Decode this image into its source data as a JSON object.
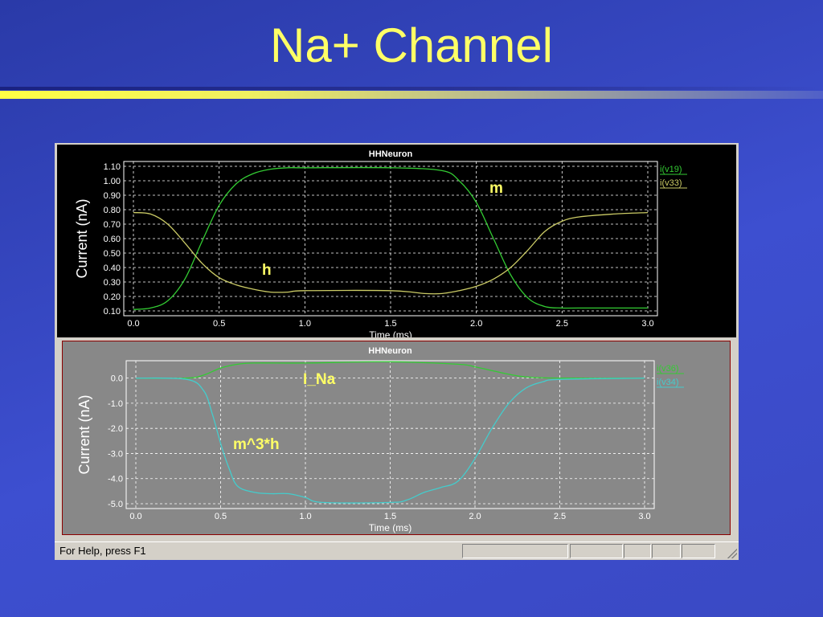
{
  "slide": {
    "title": "Na+ Channel"
  },
  "colors": {
    "background": "#3a49c4",
    "title": "#ffff66",
    "series_green": "#33cc33",
    "series_yellow": "#cccc66",
    "series_cyan": "#44cccc",
    "annotation": "#ffff66"
  },
  "statusbar": {
    "help_text": "For Help, press F1"
  },
  "annotations": {
    "m": "m",
    "h": "h",
    "i_na": "I_Na",
    "m3h": "m^3*h"
  },
  "chart_data": [
    {
      "type": "line",
      "title": "HHNeuron",
      "xlabel": "Time (ms)",
      "ylabel": "Current (nA)",
      "xlim": [
        0.0,
        3.0
      ],
      "ylim": [
        0.1,
        1.1
      ],
      "xticks": [
        "0.0",
        "0.5",
        "1.0",
        "1.5",
        "2.0",
        "2.5",
        "3.0"
      ],
      "yticks": [
        "0.10",
        "0.20",
        "0.30",
        "0.40",
        "0.50",
        "0.60",
        "0.70",
        "0.80",
        "0.90",
        "1.00",
        "1.10"
      ],
      "grid": true,
      "legend": "top-right",
      "background": "black",
      "series": [
        {
          "name": "i(v19)",
          "color": "#33cc33",
          "x": [
            0.0,
            0.1,
            0.2,
            0.3,
            0.4,
            0.5,
            0.6,
            0.7,
            0.8,
            0.9,
            1.0,
            1.5,
            1.8,
            1.9,
            2.0,
            2.1,
            2.2,
            2.3,
            2.4,
            2.5,
            2.6,
            3.0
          ],
          "y": [
            0.11,
            0.12,
            0.17,
            0.32,
            0.58,
            0.83,
            0.98,
            1.05,
            1.08,
            1.09,
            1.09,
            1.09,
            1.07,
            1.0,
            0.85,
            0.6,
            0.35,
            0.19,
            0.13,
            0.12,
            0.12,
            0.12
          ]
        },
        {
          "name": "i(v33)",
          "color": "#cccc66",
          "x": [
            0.0,
            0.1,
            0.2,
            0.3,
            0.4,
            0.5,
            0.6,
            0.7,
            0.8,
            0.9,
            1.0,
            1.5,
            1.7,
            1.8,
            1.9,
            2.0,
            2.1,
            2.2,
            2.3,
            2.4,
            2.5,
            2.6,
            2.8,
            3.0
          ],
          "y": [
            0.78,
            0.77,
            0.7,
            0.57,
            0.43,
            0.33,
            0.28,
            0.25,
            0.23,
            0.23,
            0.24,
            0.24,
            0.22,
            0.22,
            0.24,
            0.27,
            0.32,
            0.4,
            0.52,
            0.65,
            0.72,
            0.75,
            0.77,
            0.78
          ]
        }
      ]
    },
    {
      "type": "line",
      "title": "HHNeuron",
      "xlabel": "Time (ms)",
      "ylabel": "Current (nA)",
      "xlim": [
        0.0,
        3.0
      ],
      "ylim": [
        -5.0,
        0.5
      ],
      "xticks": [
        "0.0",
        "0.5",
        "1.0",
        "1.5",
        "2.0",
        "2.5",
        "3.0"
      ],
      "yticks": [
        "-5.0",
        "-4.0",
        "-3.0",
        "-2.0",
        "-1.0",
        "0.0"
      ],
      "grid": true,
      "legend": "top-right",
      "background": "gray",
      "series": [
        {
          "name": "i(v36)",
          "color": "#33cc33",
          "x": [
            0.0,
            0.3,
            0.4,
            0.5,
            0.6,
            0.7,
            1.0,
            1.5,
            1.9,
            2.0,
            2.1,
            2.2,
            2.3,
            2.5,
            3.0
          ],
          "y": [
            0.0,
            0.0,
            0.12,
            0.4,
            0.55,
            0.6,
            0.6,
            0.65,
            0.55,
            0.45,
            0.3,
            0.15,
            0.05,
            0.0,
            0.0
          ]
        },
        {
          "name": "i(v34)",
          "color": "#44cccc",
          "x": [
            0.0,
            0.3,
            0.4,
            0.45,
            0.5,
            0.55,
            0.6,
            0.7,
            0.8,
            0.9,
            1.0,
            1.1,
            1.5,
            1.6,
            1.7,
            1.8,
            1.9,
            2.0,
            2.1,
            2.2,
            2.3,
            2.4,
            2.5,
            3.0
          ],
          "y": [
            0.0,
            -0.05,
            -0.5,
            -1.4,
            -2.6,
            -3.6,
            -4.3,
            -4.55,
            -4.6,
            -4.6,
            -4.75,
            -4.95,
            -4.95,
            -4.85,
            -4.55,
            -4.35,
            -4.1,
            -3.2,
            -2.0,
            -1.0,
            -0.4,
            -0.15,
            -0.05,
            0.0
          ]
        }
      ]
    }
  ]
}
